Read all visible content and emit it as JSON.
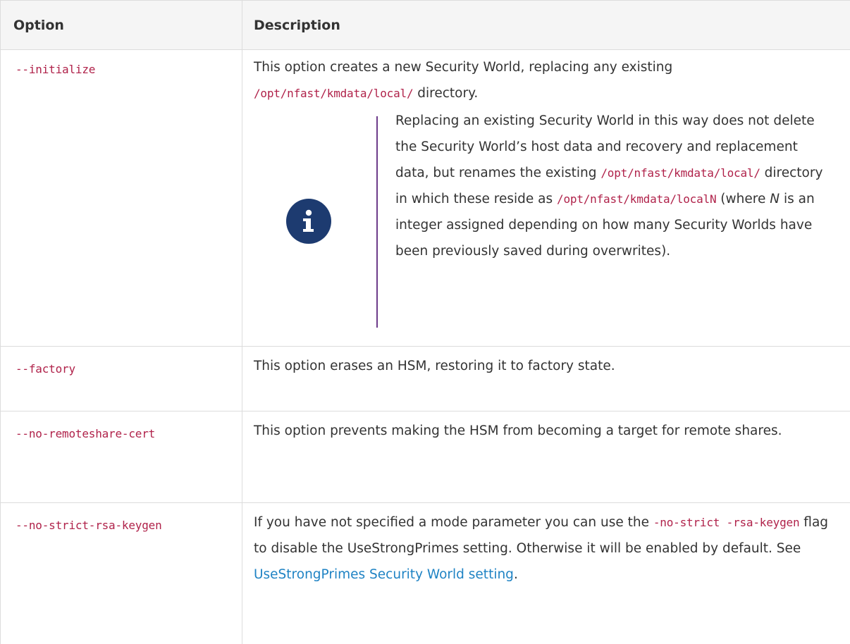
{
  "table": {
    "headers": {
      "option": "Option",
      "description": "Description"
    },
    "rows": [
      {
        "option": "--initialize",
        "desc_text1": "This option creates a new Security World, replacing any existing",
        "desc_code1": "/opt/nfast/kmdata/local/",
        "desc_text2": " directory.",
        "note": {
          "icon": "info-icon",
          "text1": "Replacing an existing Security World in this way does not delete the Security World’s host data and recovery and replacement data, but renames the existing ",
          "code1": "/opt/nfast/kmdata/local/",
          "text2": " directory in which these reside as ",
          "code2": "/opt/nfast/kmdata/localN",
          "text3": " (where ",
          "italic": "N",
          "text4": " is an integer assigned depending on how many Security Worlds have been previously saved during overwrites)."
        }
      },
      {
        "option": "--factory",
        "desc": "This option erases an HSM, restoring it to factory state."
      },
      {
        "option": "--no-remoteshare-cert",
        "desc": "This option prevents making the HSM from becoming a target for remote shares."
      },
      {
        "option": "--no-strict-rsa-keygen",
        "desc_text1": "If you have not specified a mode parameter you can use the ",
        "desc_code1": "-no-strict -rsa-keygen",
        "desc_text2": " flag to disable the UseStrongPrimes setting. Otherwise it will be enabled by default. See ",
        "link": "UseStrongPrimes Security World setting",
        "desc_text3": "."
      }
    ]
  },
  "colors": {
    "code": "#b0224a",
    "link": "#1f83c4",
    "note_bar": "#6d3b8a",
    "icon_bg": "#1d3b70"
  }
}
